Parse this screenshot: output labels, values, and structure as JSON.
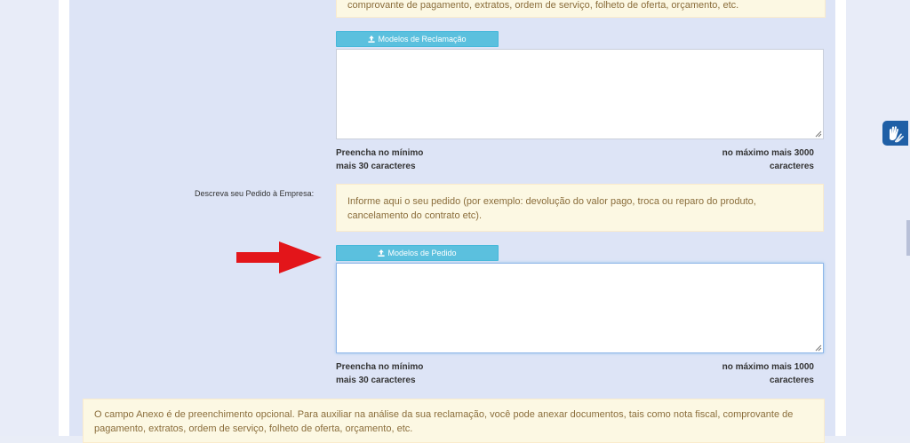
{
  "top_note": {
    "text": "comprovante de pagamento, extratos, ordem de serviço, folheto de oferta, orçamento, etc."
  },
  "reclamacao": {
    "models_button": "Modelos de Reclamação",
    "textarea_value": "",
    "counter_min_line1": "Preencha no mínimo",
    "counter_min_line2": "mais 30 caracteres",
    "counter_max_line1": "no máximo mais 3000",
    "counter_max_line2": "caracteres"
  },
  "pedido": {
    "label": "Descreva seu Pedido à Empresa:",
    "hint": "Informe aqui o seu pedido (por exemplo: devolução do valor pago, troca ou reparo do produto, cancelamento do contrato etc).",
    "models_button": "Modelos de Pedido",
    "textarea_value": "",
    "counter_min_line1": "Preencha no mínimo",
    "counter_min_line2": "mais 30 caracteres",
    "counter_max_line1": "no máximo mais 1000",
    "counter_max_line2": "caracteres"
  },
  "anexo_note": {
    "text": "O campo Anexo é de preenchimento opcional. Para auxiliar na análise da sua reclamação, você pode anexar documentos, tais como nota fiscal, comprovante de pagamento, extratos, ordem de serviço, folheto de oferta, orçamento, etc."
  },
  "icons": {
    "upload": "upload-icon",
    "arrow": "red-arrow-icon",
    "accessibility": "sign-language-hands-icon"
  },
  "colors": {
    "button_bg": "#5bc0de",
    "note_bg": "#fcf8e3",
    "note_text": "#8a6d3b",
    "arrow": "#e3151a",
    "accessibility_bg": "#1f5fa6"
  }
}
